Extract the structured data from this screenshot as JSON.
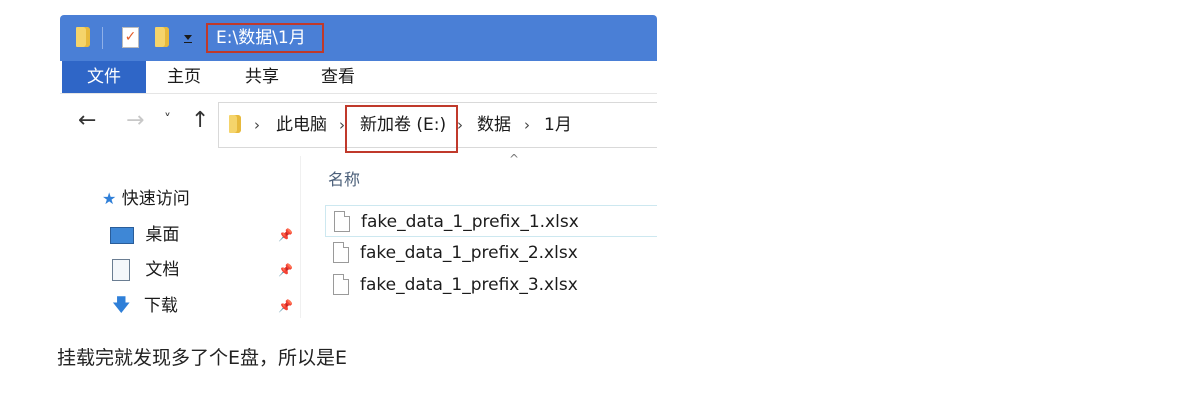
{
  "titlebar": {
    "path": "E:\\数据\\1月",
    "icons": [
      "folder-icon",
      "properties-icon",
      "new-folder-icon",
      "customize-dropdown-icon"
    ]
  },
  "ribbon": {
    "tabs": [
      "文件",
      "主页",
      "共享",
      "查看"
    ]
  },
  "nav": {
    "back": "←",
    "forward": "→",
    "recent": "˅",
    "up": "↑"
  },
  "address": {
    "crumbs": [
      "此电脑",
      "新加卷 (E:)",
      "数据",
      "1月"
    ],
    "separator": "›"
  },
  "sidebar": {
    "quick_access": "快速访问",
    "items": [
      {
        "label": "桌面",
        "icon": "desktop-icon"
      },
      {
        "label": "文档",
        "icon": "documents-icon"
      },
      {
        "label": "下载",
        "icon": "downloads-icon"
      }
    ]
  },
  "content": {
    "column_name": "名称",
    "sort_caret": "^",
    "files": [
      "fake_data_1_prefix_1.xlsx",
      "fake_data_1_prefix_2.xlsx",
      "fake_data_1_prefix_3.xlsx"
    ]
  },
  "caption": "挂载完就发现多了个E盘，所以是E",
  "colors": {
    "titlebar": "#4a7fd6",
    "file_tab": "#2f66c7",
    "highlight_box": "#c0392b"
  }
}
